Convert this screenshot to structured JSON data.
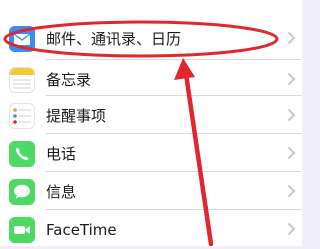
{
  "settings_list": {
    "items": [
      {
        "label": "邮件、通讯录、日历",
        "icon": "mail-icon",
        "color": "#3b8df3"
      },
      {
        "label": "备忘录",
        "icon": "notes-icon",
        "color": "#f6c83d"
      },
      {
        "label": "提醒事项",
        "icon": "reminders-icon",
        "color": "#ffffff"
      },
      {
        "label": "电话",
        "icon": "phone-icon",
        "color": "#4cd964"
      },
      {
        "label": "信息",
        "icon": "messages-icon",
        "color": "#4cd964"
      },
      {
        "label": "FaceTime",
        "icon": "facetime-icon",
        "color": "#4cd964"
      }
    ]
  },
  "annotation": {
    "highlight_color": "#e0272f",
    "arrow_color": "#e0272f"
  }
}
